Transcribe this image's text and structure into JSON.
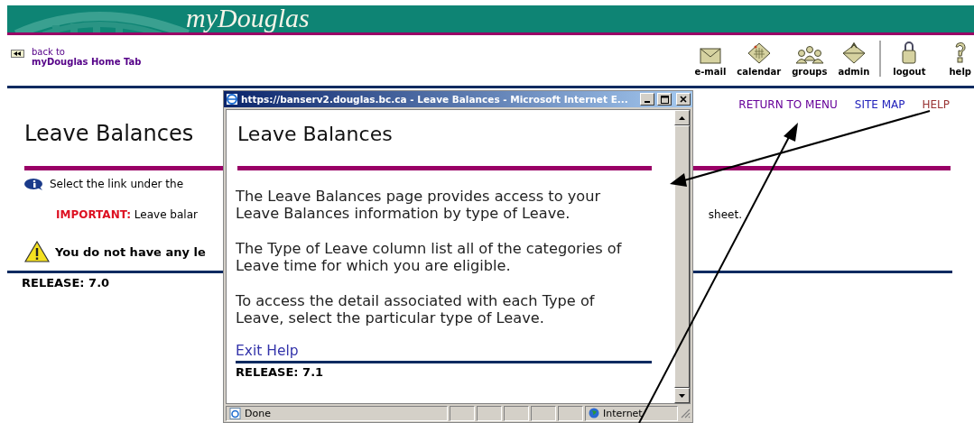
{
  "banner": {
    "title": "myDouglas"
  },
  "back_link": {
    "line_1": "back to",
    "line_2": "myDouglas Home Tab"
  },
  "toolbar": {
    "groups": [
      {
        "items": [
          {
            "label": "e-mail",
            "kind": "mail"
          },
          {
            "label": "calendar",
            "kind": "calendar"
          },
          {
            "label": "groups",
            "kind": "groups"
          },
          {
            "label": "admin",
            "kind": "admin"
          }
        ]
      },
      {
        "items": [
          {
            "label": "logout",
            "kind": "lock"
          },
          {
            "label": "help",
            "kind": "help"
          }
        ]
      }
    ]
  },
  "nav_links": [
    {
      "label": "RETURN TO MENU",
      "color": "#660099"
    },
    {
      "label": "SITE MAP",
      "color": "#2222bb"
    },
    {
      "label": "HELP",
      "color": "#993333"
    }
  ],
  "page": {
    "title": "Leave Balances",
    "info": "Select the link under the",
    "important": "**IMPORTANT:** Leave balar",
    "important_tail": "sheet.",
    "warning": "You do not have any le",
    "release": "RELEASE: 7.0"
  },
  "popup": {
    "title": "https://banserv2.douglas.bc.ca - Leave Balances - Microsoft Internet E...",
    "heading": "Leave Balances",
    "paragraphs": [
      "The Leave Balances page provides access to your Leave Balances information by type of Leave.",
      "The Type of Leave column list all of the categories of Leave time for which you are eligible.",
      "To access the detail associated with each Type of Leave, select the particular type of Leave."
    ],
    "link": "Exit Help",
    "release": "RELEASE: 7.1",
    "status": {
      "text": "Done",
      "zone": "Internet"
    }
  }
}
